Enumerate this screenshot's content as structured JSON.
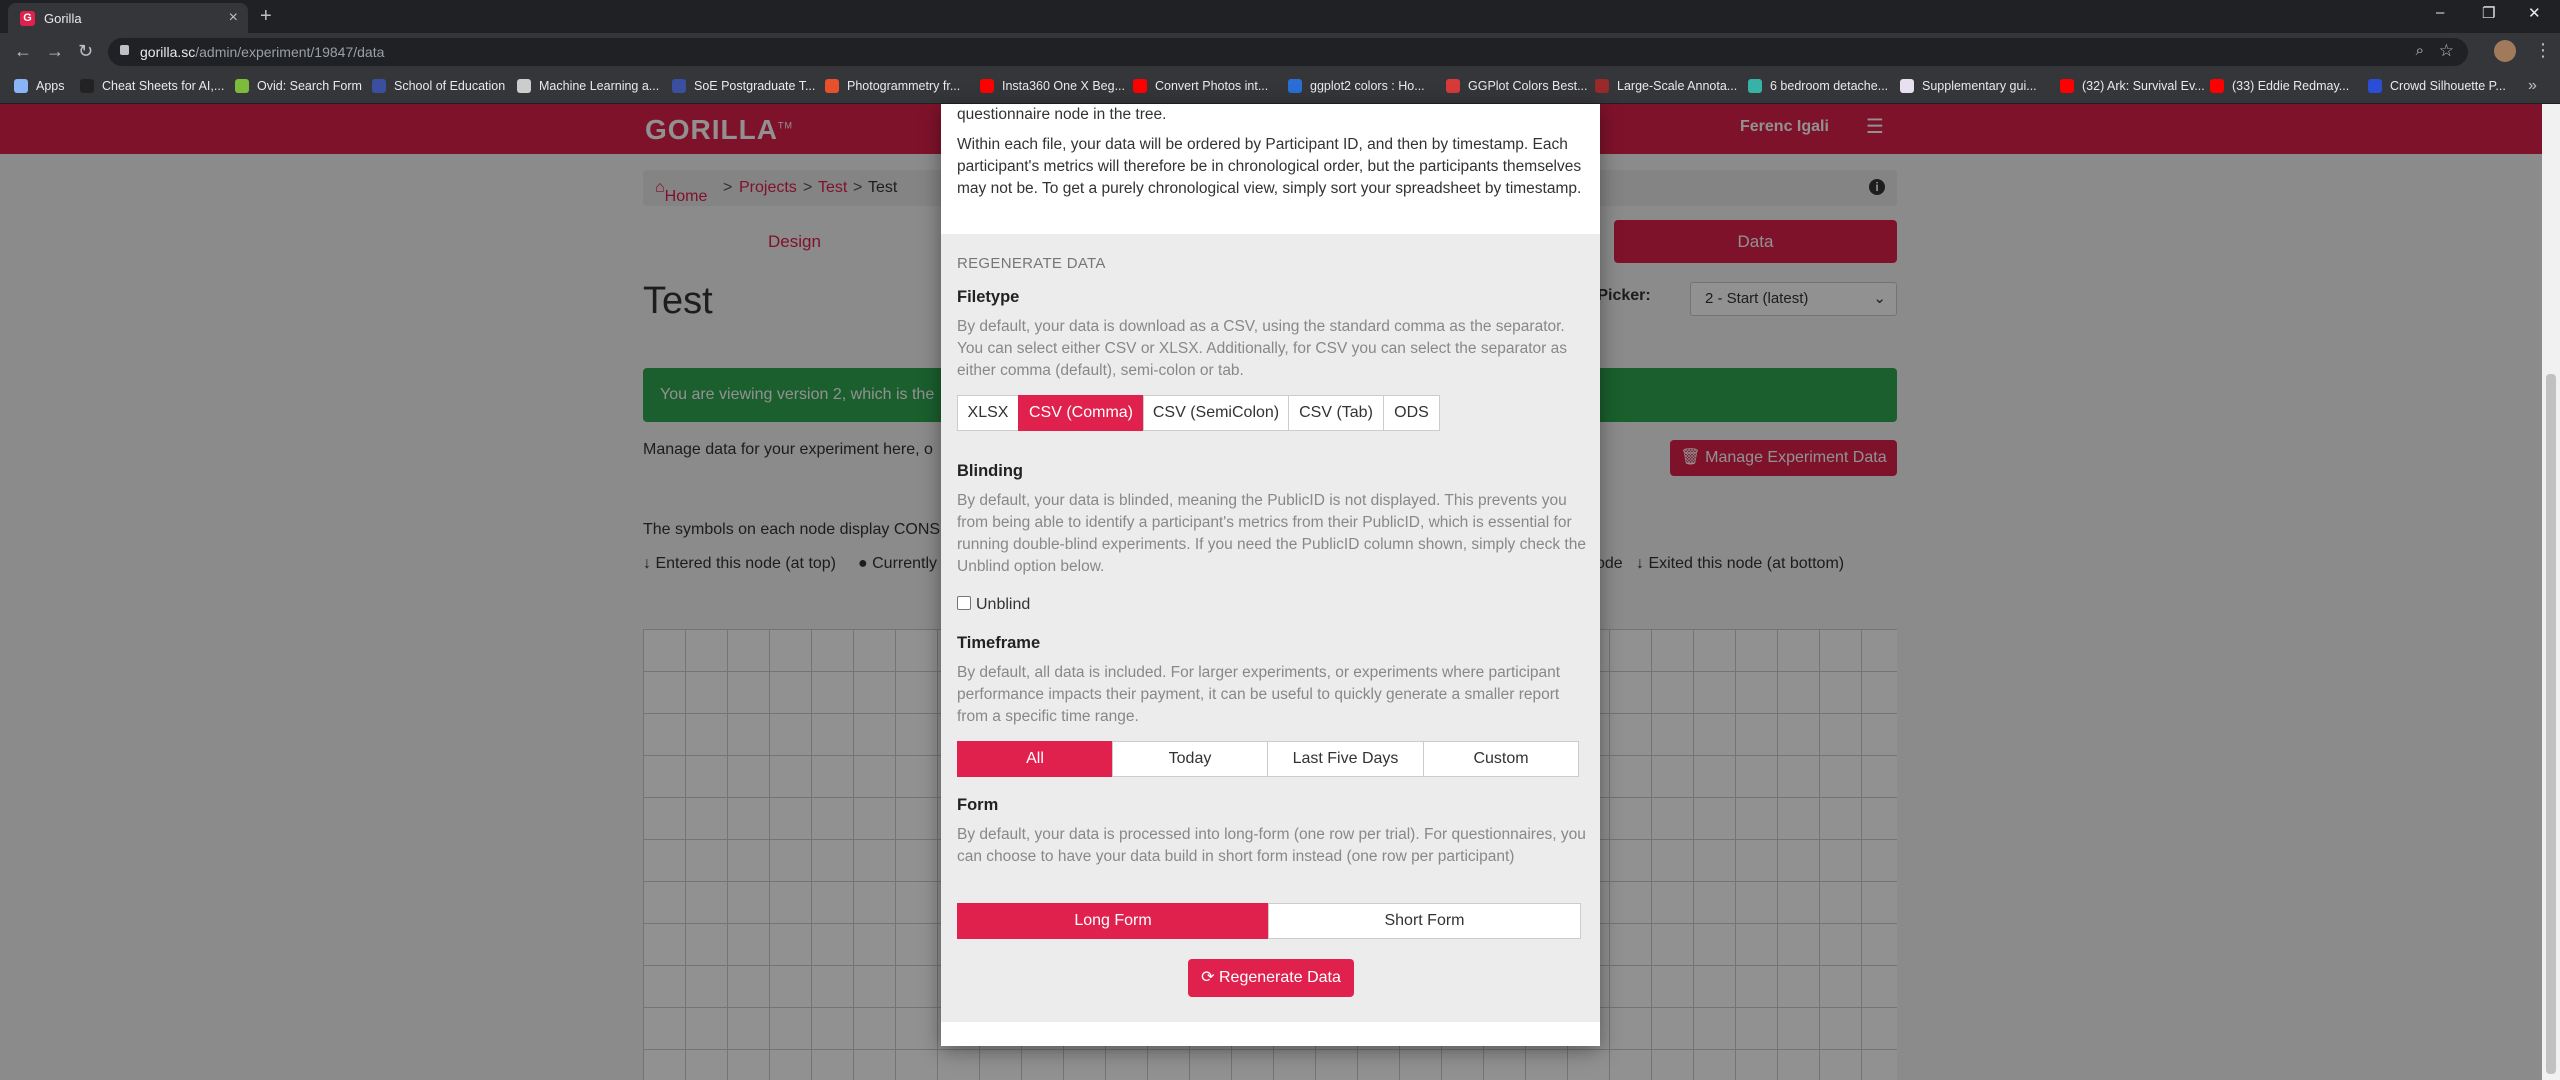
{
  "browser": {
    "tab_title": "Gorilla",
    "tab_favicon": "G",
    "url_host": "gorilla.sc",
    "url_path": "/admin/experiment/19847/data",
    "bookmarks": [
      {
        "label": "Apps",
        "color": "#8ab4f8"
      },
      {
        "label": "Cheat Sheets for AI,...",
        "color": "#222222"
      },
      {
        "label": "Ovid: Search Form",
        "color": "#7dbb3a"
      },
      {
        "label": "School of Education",
        "color": "#3a4fa0"
      },
      {
        "label": "Machine Learning a...",
        "color": "#cccccc"
      },
      {
        "label": "SoE Postgraduate T...",
        "color": "#3a4fa0"
      },
      {
        "label": "Photogrammetry fr...",
        "color": "#e8502a"
      },
      {
        "label": "Insta360 One X Beg...",
        "color": "#ff0000"
      },
      {
        "label": "Convert Photos int...",
        "color": "#ff0000"
      },
      {
        "label": "ggplot2 colors : Ho...",
        "color": "#2a6fd6"
      },
      {
        "label": "GGPlot Colors Best...",
        "color": "#d83a3a"
      },
      {
        "label": "Large-Scale Annota...",
        "color": "#9a2a2a"
      },
      {
        "label": "6 bedroom detache...",
        "color": "#38b2a6"
      },
      {
        "label": "Supplementary gui...",
        "color": "#e8e0f0"
      },
      {
        "label": "(32) Ark: Survival Ev...",
        "color": "#ff0000"
      },
      {
        "label": "(33) Eddie Redmay...",
        "color": "#ff0000"
      },
      {
        "label": "Crowd Silhouette P...",
        "color": "#2a4fd6"
      }
    ]
  },
  "app": {
    "logo": "GORILLA",
    "logo_tm": "TM",
    "user_name": "Ferenc Igali",
    "breadcrumb": {
      "home": "Home",
      "projects": "Projects",
      "test": "Test",
      "current": "Test",
      "sep": ">"
    },
    "design_tab": "Design",
    "data_tab": "Data",
    "page_title": "Test",
    "version_picker_label": "sion Picker:",
    "version_picker_value": "2 - Start (latest)",
    "alert_text": "You are viewing version 2, which is the",
    "manage_text": "Manage data for your experiment here, o",
    "manage_button": "Manage Experiment Data",
    "symbols_text": "The symbols on each node display CONS",
    "legend_entered": "Entered this node (at top)",
    "legend_current": "Currently",
    "legend_node": "ode",
    "legend_exited": "Exited this node (at bottom)"
  },
  "modal": {
    "top_line": "questionnaire node in the tree.",
    "order_text": "Within each file, your data will be ordered by Participant ID, and then by timestamp. Each participant's metrics will therefore be in chronological order, but the participants themselves may not be. To get a purely chronological view, simply sort your spreadsheet by timestamp.",
    "section_title": "REGENERATE DATA",
    "filetype": {
      "heading": "Filetype",
      "desc": "By default, your data is download as a CSV, using the standard comma as the separator. You can select either CSV or XLSX. Additionally, for CSV you can select the separator as either comma (default), semi-colon or tab.",
      "options": [
        "XLSX",
        "CSV (Comma)",
        "CSV (SemiColon)",
        "CSV (Tab)",
        "ODS"
      ],
      "selected": 1
    },
    "blinding": {
      "heading": "Blinding",
      "desc": "By default, your data is blinded, meaning the PublicID is not displayed. This prevents you from being able to identify a participant's metrics from their PublicID, which is essential for running double-blind experiments. If you need the PublicID column shown, simply check the Unblind option below.",
      "checkbox_label": "Unblind",
      "checked": false
    },
    "timeframe": {
      "heading": "Timeframe",
      "desc": "By default, all data is included. For larger experiments, or experiments where participant performance impacts their payment, it can be useful to quickly generate a smaller report from a specific time range.",
      "options": [
        "All",
        "Today",
        "Last Five Days",
        "Custom"
      ],
      "selected": 0
    },
    "form": {
      "heading": "Form",
      "desc": "By default, your data is processed into long-form (one row per trial). For questionnaires, you can choose to have your data build in short form instead (one row per participant)",
      "options": [
        "Long Form",
        "Short Form"
      ],
      "selected": 0
    },
    "regenerate_button": "Regenerate Data"
  },
  "colors": {
    "accent": "#e0204d",
    "success": "#2fa84f"
  }
}
